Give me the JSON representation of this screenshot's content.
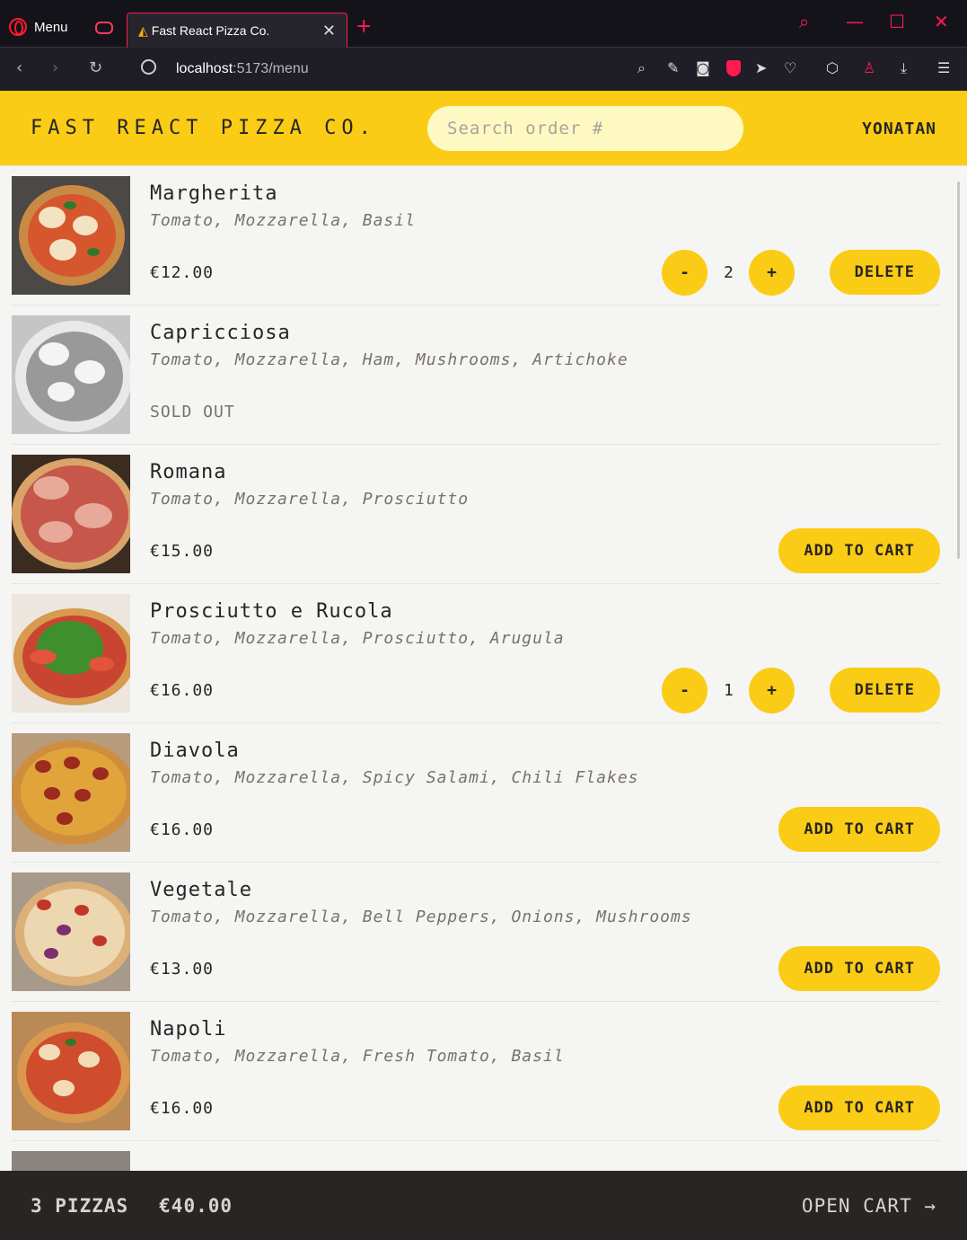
{
  "browser": {
    "menu_label": "Menu",
    "tab_title": "Fast React Pizza Co.",
    "url_host": "localhost",
    "url_path": ":5173/menu"
  },
  "header": {
    "logo": "Fast React Pizza Co.",
    "search_placeholder": "Search order #",
    "username": "YONATAN"
  },
  "menu": [
    {
      "name": "Margherita",
      "ingredients": "Tomato, Mozzarella, Basil",
      "price": "€12.00",
      "quantity": "2",
      "action": "DELETE"
    },
    {
      "name": "Capricciosa",
      "ingredients": "Tomato, Mozzarella, Ham, Mushrooms, Artichoke",
      "status": "Sold out"
    },
    {
      "name": "Romana",
      "ingredients": "Tomato, Mozzarella, Prosciutto",
      "price": "€15.00",
      "action": "ADD TO CART"
    },
    {
      "name": "Prosciutto e Rucola",
      "ingredients": "Tomato, Mozzarella, Prosciutto, Arugula",
      "price": "€16.00",
      "quantity": "1",
      "action": "DELETE"
    },
    {
      "name": "Diavola",
      "ingredients": "Tomato, Mozzarella, Spicy Salami, Chili Flakes",
      "price": "€16.00",
      "action": "ADD TO CART"
    },
    {
      "name": "Vegetale",
      "ingredients": "Tomato, Mozzarella, Bell Peppers, Onions, Mushrooms",
      "price": "€13.00",
      "action": "ADD TO CART"
    },
    {
      "name": "Napoli",
      "ingredients": "Tomato, Mozzarella, Fresh Tomato, Basil",
      "price": "€16.00",
      "action": "ADD TO CART"
    }
  ],
  "controls": {
    "decrease": "-",
    "increase": "+"
  },
  "cart": {
    "count": "3 PIZZAS",
    "total": "€40.00",
    "open_label": "OPEN CART →"
  },
  "colors": {
    "accent": "#facc15",
    "footer": "#292524",
    "background": "#f5f5f4"
  }
}
